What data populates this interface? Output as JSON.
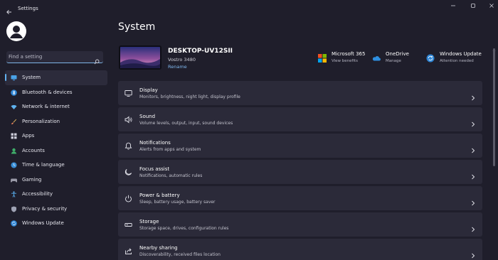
{
  "window": {
    "title": "Settings"
  },
  "search": {
    "placeholder": "Find a setting"
  },
  "sidebar": {
    "items": [
      {
        "label": "System",
        "icon": "system-icon",
        "selected": true
      },
      {
        "label": "Bluetooth & devices",
        "icon": "bluetooth-icon"
      },
      {
        "label": "Network & internet",
        "icon": "wifi-icon"
      },
      {
        "label": "Personalization",
        "icon": "paintbrush-icon"
      },
      {
        "label": "Apps",
        "icon": "apps-icon"
      },
      {
        "label": "Accounts",
        "icon": "person-icon"
      },
      {
        "label": "Time & language",
        "icon": "globe-clock-icon"
      },
      {
        "label": "Gaming",
        "icon": "gamepad-icon"
      },
      {
        "label": "Accessibility",
        "icon": "accessibility-icon"
      },
      {
        "label": "Privacy & security",
        "icon": "shield-icon"
      },
      {
        "label": "Windows Update",
        "icon": "windows-update-icon"
      }
    ]
  },
  "main": {
    "title": "System",
    "device": {
      "name": "DESKTOP-UV12SII",
      "model": "Vostro 3480",
      "rename_label": "Rename"
    },
    "quick_links": [
      {
        "title": "Microsoft 365",
        "subtitle": "View benefits",
        "icon": "microsoft-365-icon"
      },
      {
        "title": "OneDrive",
        "subtitle": "Manage",
        "icon": "onedrive-icon"
      },
      {
        "title": "Windows Update",
        "subtitle": "Attention needed",
        "icon": "windows-update-icon"
      }
    ],
    "cards": [
      {
        "title": "Display",
        "subtitle": "Monitors, brightness, night light, display profile",
        "icon": "monitor-icon"
      },
      {
        "title": "Sound",
        "subtitle": "Volume levels, output, input, sound devices",
        "icon": "speaker-icon"
      },
      {
        "title": "Notifications",
        "subtitle": "Alerts from apps and system",
        "icon": "bell-icon"
      },
      {
        "title": "Focus assist",
        "subtitle": "Notifications, automatic rules",
        "icon": "moon-icon"
      },
      {
        "title": "Power & battery",
        "subtitle": "Sleep, battery usage, battery saver",
        "icon": "power-icon"
      },
      {
        "title": "Storage",
        "subtitle": "Storage space, drives, configuration rules",
        "icon": "storage-icon"
      },
      {
        "title": "Nearby sharing",
        "subtitle": "Discoverability, received files location",
        "icon": "share-icon"
      }
    ]
  },
  "colors": {
    "background": "#1f1e2b",
    "card": "#2b2a39",
    "accent": "#62b1f0",
    "link": "#7fb8ee"
  }
}
